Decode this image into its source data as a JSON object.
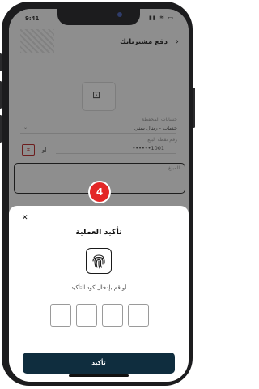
{
  "status_bar": {
    "time": "9:41",
    "icons": "▮▮ ≋ ▭"
  },
  "app_bar": {
    "title": "دفع مشترياتك",
    "back_glyph": "‹"
  },
  "background_form": {
    "card_icon_glyph": "⊡",
    "wallet_label": "حسابات المحفظة",
    "wallet_value": "حساب - رينال يمني",
    "merchant_label": "رقم نقطة البيع",
    "merchant_value": "1001••••••",
    "or_text": "او",
    "amount_label": "المبلغ"
  },
  "step_badge": "4",
  "modal": {
    "close_glyph": "✕",
    "title": "تأكيد العملية",
    "hint": "أو قم بإدخال كود التأكيد",
    "otp_digits": [
      "",
      "",
      "",
      ""
    ],
    "confirm_label": "تأكيد"
  },
  "colors": {
    "primary": "#0f2d3e",
    "badge": "#e32626",
    "overlay": "rgba(0,0,0,0.42)"
  }
}
